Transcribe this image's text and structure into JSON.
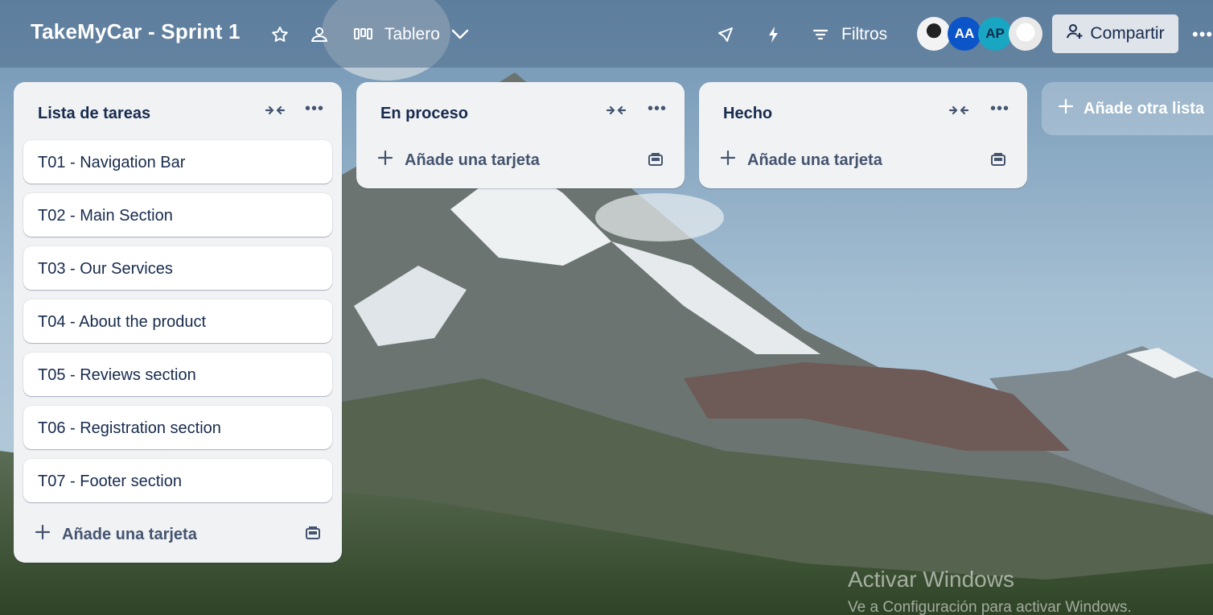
{
  "header": {
    "board_title": "TakeMyCar - Sprint 1",
    "view_label": "Tablero",
    "filters_label": "Filtros",
    "share_label": "Compartir",
    "more_label": "•••",
    "avatars": [
      {
        "initials": ""
      },
      {
        "initials": "AA"
      },
      {
        "initials": "AP"
      },
      {
        "initials": ""
      }
    ]
  },
  "lists": [
    {
      "title": "Lista de tareas",
      "cards": [
        "T01 - Navigation Bar",
        "T02 - Main Section",
        "T03 - Our Services",
        "T04 - About the product",
        "T05 - Reviews section",
        "T06 - Registration section",
        "T07 - Footer section"
      ],
      "add_card_label": "Añade una tarjeta"
    },
    {
      "title": "En proceso",
      "cards": [],
      "add_card_label": "Añade una tarjeta"
    },
    {
      "title": "Hecho",
      "cards": [],
      "add_card_label": "Añade una tarjeta"
    }
  ],
  "add_list_label": "Añade otra lista",
  "list_more_label": "•••",
  "watermark": {
    "line1": "Activar Windows",
    "line2": "Ve a Configuración para activar Windows."
  }
}
